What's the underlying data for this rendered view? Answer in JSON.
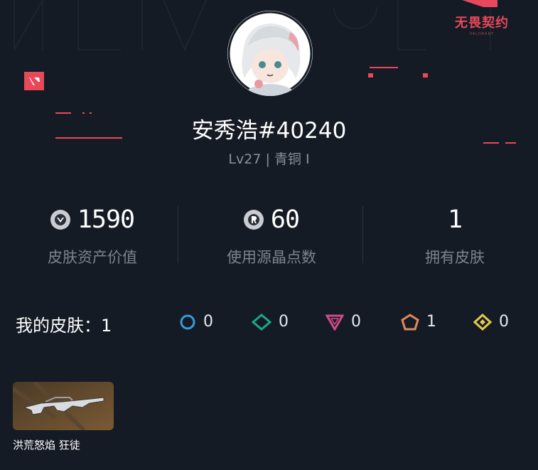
{
  "brand": {
    "name_cn": "无畏契约",
    "name_en": "VALORANT",
    "accent": "#e8485a"
  },
  "profile": {
    "name": "安秀浩#40240",
    "level": "Lv27 | 青铜 I"
  },
  "stats": [
    {
      "value": "1590",
      "label": "皮肤资产价值",
      "icon": "valorant-points-icon"
    },
    {
      "value": "60",
      "label": "使用源晶点数",
      "icon": "radianite-icon"
    },
    {
      "value": "1",
      "label": "拥有皮肤",
      "icon": ""
    }
  ],
  "skins": {
    "title": "我的皮肤：1",
    "tiers": [
      {
        "icon": "select-tier-icon",
        "count": "0",
        "color": "#3a9ad9"
      },
      {
        "icon": "deluxe-tier-icon",
        "count": "0",
        "color": "#1aa88a"
      },
      {
        "icon": "premium-tier-icon",
        "count": "0",
        "color": "#d04a8a"
      },
      {
        "icon": "exclusive-tier-icon",
        "count": "1",
        "color": "#e0885a"
      },
      {
        "icon": "ultra-tier-icon",
        "count": "0",
        "color": "#e6c84a"
      }
    ],
    "items": [
      {
        "name": "洪荒怒焰 狂徒"
      }
    ]
  }
}
